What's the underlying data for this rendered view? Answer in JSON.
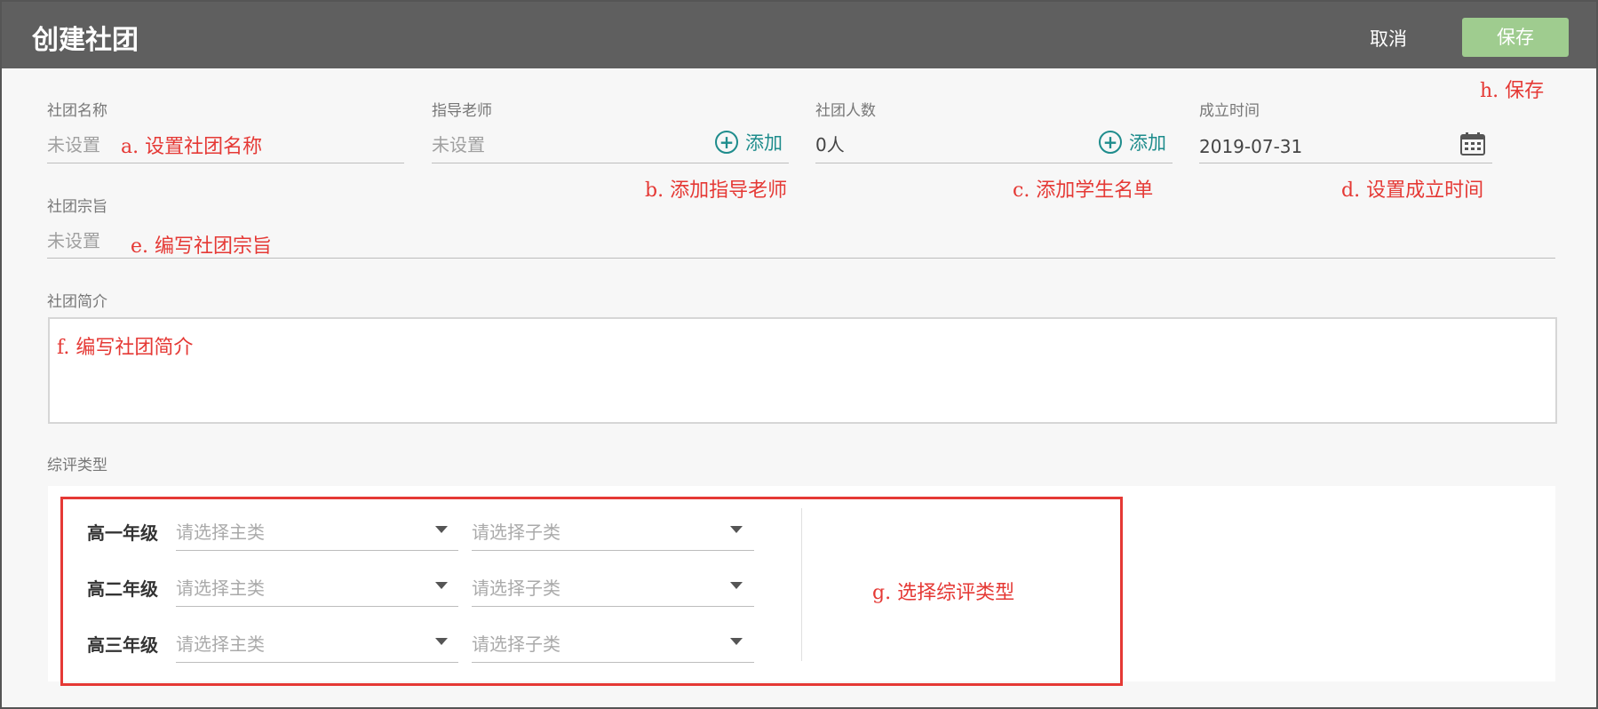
{
  "header": {
    "title": "创建社团",
    "cancel_label": "取消",
    "save_label": "保存"
  },
  "form": {
    "club_name": {
      "label": "社团名称",
      "value": "未设置"
    },
    "advisor": {
      "label": "指导老师",
      "value": "未设置",
      "add_label": "添加"
    },
    "member_count": {
      "label": "社团人数",
      "value": "0人",
      "add_label": "添加"
    },
    "founded": {
      "label": "成立时间",
      "value": "2019-07-31"
    },
    "purpose": {
      "label": "社团宗旨",
      "value": "未设置"
    },
    "intro": {
      "label": "社团简介"
    },
    "eval_type": {
      "label": "综评类型",
      "rows": [
        {
          "grade": "高一年级",
          "main_placeholder": "请选择主类",
          "sub_placeholder": "请选择子类"
        },
        {
          "grade": "高二年级",
          "main_placeholder": "请选择主类",
          "sub_placeholder": "请选择子类"
        },
        {
          "grade": "高三年级",
          "main_placeholder": "请选择主类",
          "sub_placeholder": "请选择子类"
        }
      ]
    }
  },
  "annotations": {
    "a": "a. 设置社团名称",
    "b": "b. 添加指导老师",
    "c": "c. 添加学生名单",
    "d": "d. 设置成立时间",
    "e": "e. 编写社团宗旨",
    "f": "f. 编写社团简介",
    "g": "g. 选择综评类型",
    "h": "h. 保存"
  },
  "colors": {
    "header_bg": "#5f5f5f",
    "save_button": "#9fcc8f",
    "accent_teal": "#1e8c8c",
    "annotation_red": "#e53935"
  },
  "icons": {
    "add": "plus-circle-icon",
    "date": "calendar-icon",
    "dropdown": "caret-down-icon"
  }
}
